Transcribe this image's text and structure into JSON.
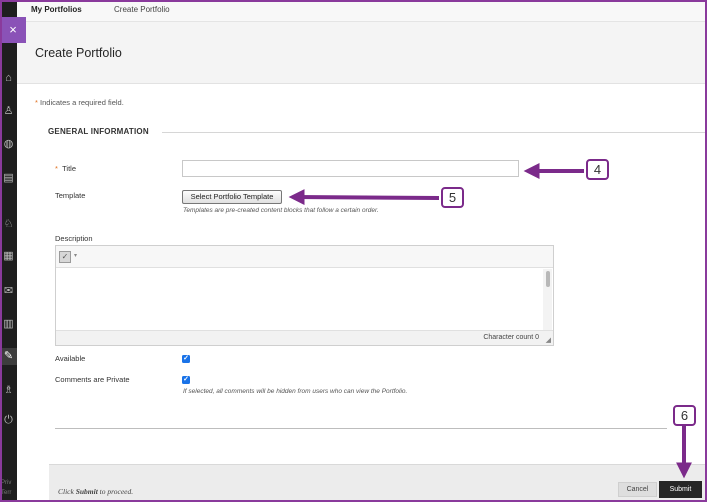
{
  "breadcrumb": {
    "items": [
      {
        "label": "My Portfolios",
        "active": true
      },
      {
        "label": "Create Portfolio",
        "active": false
      }
    ]
  },
  "page": {
    "title": "Create Portfolio"
  },
  "form": {
    "required_marker": "*",
    "required_note": "Indicates a required field.",
    "section_title": "GENERAL INFORMATION",
    "title_label": "Title",
    "title_value": "",
    "template_label": "Template",
    "template_button": "Select Portfolio Template",
    "template_hint": "Templates are pre-created content blocks that follow a certain order.",
    "description_label": "Description",
    "char_count": "Character count 0",
    "available_label": "Available",
    "available_checked": true,
    "comments_label": "Comments are Private",
    "comments_checked": true,
    "comments_hint": "If selected, all comments will be hidden from users who can view the Portfolio."
  },
  "footer": {
    "hint_prefix": "Click",
    "hint_bold": "Submit",
    "hint_suffix": "to proceed.",
    "cancel_label": "Cancel",
    "submit_label": "Submit"
  },
  "callouts": [
    "4",
    "5",
    "6"
  ],
  "nav_rail": {
    "close_icon": "×",
    "icons": [
      "institution-icon",
      "user-icon",
      "globe-icon",
      "calendar-page-icon",
      "groups-icon",
      "grid-calendar-icon",
      "mail-icon",
      "grades-icon",
      "tools-icon",
      "people-icon",
      "sign-out-icon"
    ],
    "peek_text": [
      "Priv",
      "Terr"
    ]
  },
  "colors": {
    "accent_purple": "#8a52b7",
    "annotation_purple": "#7b2a8a",
    "required_star": "#e0701f",
    "checkbox_blue": "#1a73e8",
    "submit_bg": "#262626"
  }
}
